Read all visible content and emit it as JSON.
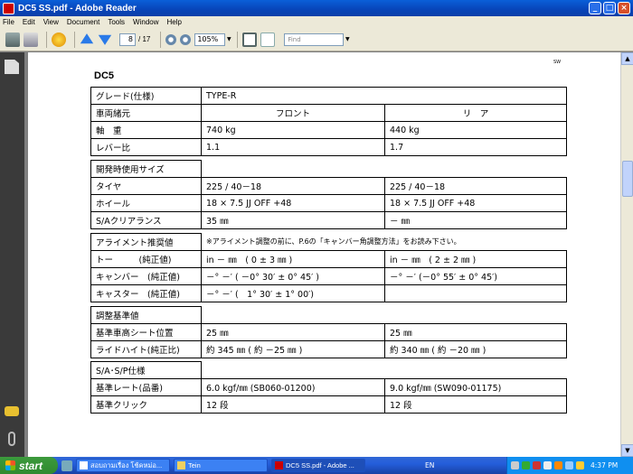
{
  "window": {
    "title": "DC5 SS.pdf - Adobe Reader"
  },
  "menu": [
    "File",
    "Edit",
    "View",
    "Document",
    "Tools",
    "Window",
    "Help"
  ],
  "toolbar": {
    "page_value": "8",
    "page_total": "/ 17",
    "zoom_value": "105%",
    "find_placeholder": "Find"
  },
  "doc": {
    "heading": "DC5",
    "corner_mark": "SW",
    "rows": {
      "grade_label": "グレード(仕様)",
      "grade_value": "TYPE-R",
      "spec_label": "車両緒元",
      "front": "フロント",
      "rear": "リ　ア",
      "axle_label": "軸　重",
      "axle_front": "740 kg",
      "axle_rear": "440 kg",
      "lever_label": "レバー比",
      "lever_front": "1.1",
      "lever_rear": "1.7",
      "dev_label": "開発時使用サイズ",
      "tire_label": "タイヤ",
      "tire_front": "225 / 40－18",
      "tire_rear": "225 / 40－18",
      "wheel_label": "ホイール",
      "wheel_front": "18 × 7.5 JJ OFF +48",
      "wheel_rear": "18 × 7.5 JJ OFF +48",
      "clear_label": "S/Aクリアランス",
      "clear_front": "35 ㎜",
      "clear_rear": "－ ㎜",
      "align_label": "アライメント推奨値",
      "align_note": "※アライメント調整の前に、P.6の「キャンバー角調整方法」をお読み下さい。",
      "toe_label": "トー　　　(純正値)",
      "toe_front": "in － ㎜　( 0 ± 3 ㎜ )",
      "toe_rear": "in － ㎜　( 2 ± 2 ㎜ )",
      "camber_label": "キャンバー　(純正値)",
      "camber_front": "－° －′ ( －0° 30′ ± 0° 45′ )",
      "camber_rear": "－° －′ (－0° 55′ ± 0° 45′)",
      "caster_label": "キャスター　(純正値)",
      "caster_front": "－° －′ (　1° 30′ ± 1° 00′)",
      "adj_label": "調整基準値",
      "seat_label": "基準車高シート位置",
      "seat_front": "25 ㎜",
      "seat_rear": "25 ㎜",
      "ride_label": "ライドハイト(純正比)",
      "ride_front": "約 345 ㎜ ( 約 －25 ㎜ )",
      "ride_rear": "約 340 ㎜ ( 約 －20 ㎜ )",
      "sasp_label": "S/A･S/P仕様",
      "rate_label": "基準レート(品番)",
      "rate_front": "6.0 kgf/㎜ (SB060-01200)",
      "rate_rear": "9.0 kgf/㎜ (SW090-01175)",
      "click_label": "基準クリック",
      "click_front": "12 段",
      "click_rear": "12 段"
    }
  },
  "taskbar": {
    "start": "start",
    "tasks": [
      "สอบถามเรื่อง โช้คหม่อ...",
      "Tein",
      "DC5 SS.pdf - Adobe ..."
    ],
    "lang": "EN",
    "clock": "4:37 PM"
  }
}
